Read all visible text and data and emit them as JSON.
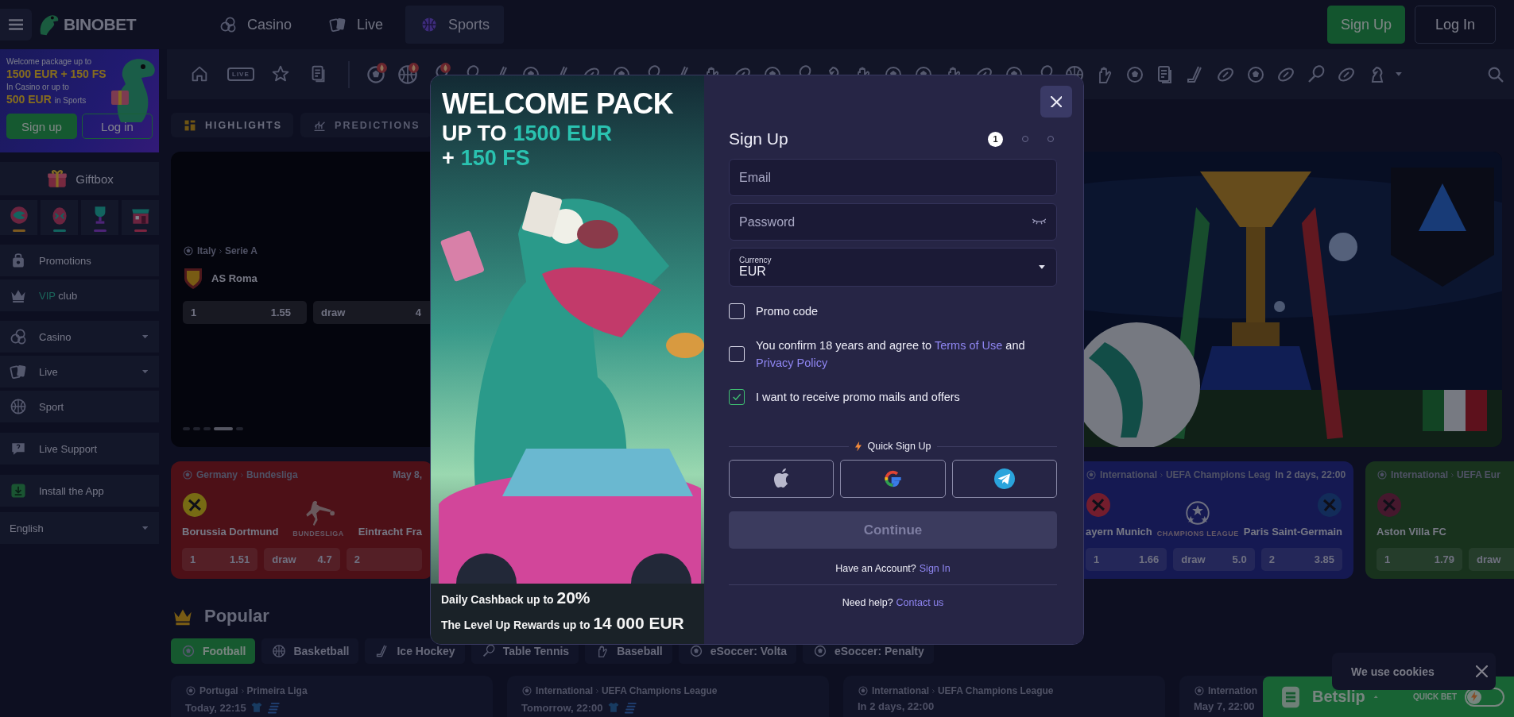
{
  "header": {
    "brand": "BINOBET",
    "nav": [
      {
        "label": "Casino",
        "selected": false
      },
      {
        "label": "Live",
        "selected": false
      },
      {
        "label": "Sports",
        "selected": true
      }
    ],
    "sign_up": "Sign Up",
    "log_in": "Log In"
  },
  "sidebar": {
    "promo": {
      "line1": "Welcome package up to",
      "amount1": "1500 EUR + 150 FS",
      "line3": "In Casino or up to",
      "amount2": "500 EUR",
      "suffix2": "in Sports",
      "sign_up": "Sign up",
      "log_in": "Log in"
    },
    "giftbox": "Giftbox",
    "groups": [
      [
        {
          "kind": "link",
          "label": "Promotions"
        },
        {
          "kind": "link",
          "accent": "VIP",
          "label": "club"
        }
      ],
      [
        {
          "kind": "group",
          "label": "Casino",
          "expanded": false
        },
        {
          "kind": "group",
          "label": "Live",
          "expanded": false
        },
        {
          "kind": "link",
          "label": "Sport"
        }
      ],
      [
        {
          "kind": "link",
          "label": "Live Support"
        }
      ],
      [
        {
          "kind": "link",
          "label": "Install the App"
        }
      ]
    ],
    "language": {
      "label": "English",
      "expanded": false
    }
  },
  "sports_bar": {
    "live_label": "LIVE"
  },
  "feed_tabs": [
    {
      "label": "HIGHLIGHTS",
      "selected": true
    },
    {
      "label": "PREDICTIONS",
      "selected": false
    }
  ],
  "hero": {
    "country": "Italy",
    "league": "Serie A",
    "team": "AS Roma",
    "odds": [
      {
        "label": "1",
        "value": "1.55"
      },
      {
        "label": "draw",
        "value": "4"
      }
    ],
    "slides": [
      {
        "selected": false
      },
      {
        "selected": false
      },
      {
        "selected": false
      },
      {
        "selected": true
      },
      {
        "selected": false
      }
    ],
    "kind": "picture"
  },
  "matches": [
    {
      "country": "Germany",
      "league": "Bundesliga",
      "time": "May 8,",
      "emblem": "BUNDESLIGA",
      "teams": [
        {
          "name": "Borussia Dortmund",
          "logo": true
        },
        {
          "name": "Eintracht Fra",
          "logo": false
        }
      ],
      "odds": [
        {
          "label": "1",
          "value": "1.51"
        },
        {
          "label": "draw",
          "value": "4.7"
        },
        {
          "label": "2"
        }
      ]
    },
    {
      "country": "International",
      "league": "UEFA Champions Leag",
      "time": "In 2 days, 22:00",
      "emblem": "CHAMPIONS LEAGUE",
      "teams": [
        {
          "name": "ayern Munich",
          "logo": true
        },
        {
          "name": "Paris Saint-Germain",
          "logo": true
        }
      ],
      "odds": [
        {
          "label": "1",
          "value": "1.66"
        },
        {
          "label": "draw",
          "value": "5.0"
        },
        {
          "label": "2",
          "value": "3.85"
        }
      ]
    },
    {
      "country": "International",
      "league": "UEFA Eur",
      "teams": [
        {
          "name": "Aston Villa FC",
          "logo": true
        }
      ],
      "odds": [
        {
          "label": "1",
          "value": "1.79"
        },
        {
          "label": "draw"
        }
      ]
    }
  ],
  "popular": {
    "title": "Popular",
    "sports": [
      {
        "label": "Football",
        "selected": true
      },
      {
        "label": "Basketball",
        "selected": false
      },
      {
        "label": "Ice Hockey",
        "selected": false
      },
      {
        "label": "Table Tennis",
        "selected": false
      },
      {
        "label": "Baseball",
        "selected": false
      },
      {
        "label": "eSoccer: Volta",
        "selected": false
      },
      {
        "label": "eSoccer: Penalty",
        "selected": false
      }
    ]
  },
  "upcoming": [
    {
      "country": "Portugal",
      "league": "Primeira Liga",
      "time": "Today, 22:15",
      "extras": true
    },
    {
      "country": "International",
      "league": "UEFA Champions League",
      "time": "Tomorrow, 22:00",
      "extras": true
    },
    {
      "country": "International",
      "league": "UEFA Champions League",
      "time": "In 2 days, 22:00",
      "extras": false
    },
    {
      "country": "Internation",
      "time": "May 7, 22:00",
      "extras": false
    }
  ],
  "modal": {
    "promo": {
      "title": "WELCOME PACK",
      "line2_prefix": "UP TO",
      "line2_amount": "1500 EUR",
      "line3_prefix": "+",
      "line3_amount": "150 FS",
      "perk1": "Daily Cashback up to **20%**",
      "perk2": "The Level Up Rewards up to **14 000 EUR**",
      "kind": "picture"
    },
    "title": "Sign Up",
    "steps": [
      {
        "label": "1",
        "selected": true
      },
      {
        "selected": false
      },
      {
        "selected": false
      }
    ],
    "fields": [
      {
        "kind": "text",
        "placeholder": "Email"
      },
      {
        "kind": "password",
        "placeholder": "Password"
      },
      {
        "kind": "select",
        "label": "Currency",
        "value": "EUR"
      }
    ],
    "checks": [
      {
        "checked": false,
        "text": "Promo code"
      },
      {
        "checked": false,
        "text": "You confirm 18 years and agree to",
        "links": [
          "Terms of Use",
          "Privacy Policy"
        ],
        "joiner": "and"
      },
      {
        "checked": true,
        "text": "I want to receive promo mails and offers"
      }
    ],
    "quick_label": "Quick Sign Up",
    "socials": [
      {
        "kind": "apple"
      },
      {
        "kind": "google"
      },
      {
        "kind": "telegram"
      }
    ],
    "continue": {
      "label": "Continue",
      "disabled": true
    },
    "account": {
      "text": "Have an Account?",
      "link": "Sign In"
    },
    "help": {
      "text": "Need help?",
      "link": "Contact us"
    }
  },
  "cookie": {
    "text": "We use cookies"
  },
  "betslip": {
    "label": "Betslip",
    "quick_bet": "QUICK BET",
    "quick_bet_on": false
  }
}
